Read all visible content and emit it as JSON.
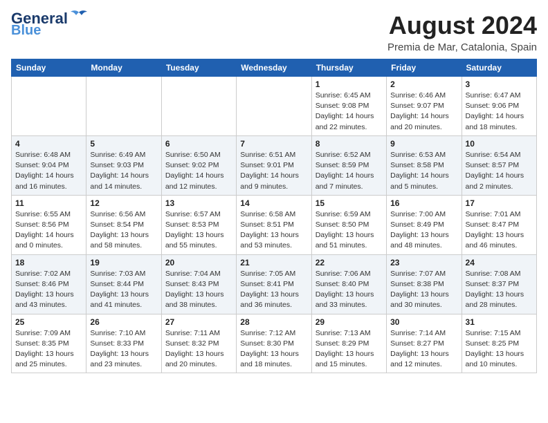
{
  "header": {
    "logo_general": "General",
    "logo_blue": "Blue",
    "month_title": "August 2024",
    "subtitle": "Premia de Mar, Catalonia, Spain"
  },
  "weekdays": [
    "Sunday",
    "Monday",
    "Tuesday",
    "Wednesday",
    "Thursday",
    "Friday",
    "Saturday"
  ],
  "weeks": [
    [
      {
        "day": "",
        "info": ""
      },
      {
        "day": "",
        "info": ""
      },
      {
        "day": "",
        "info": ""
      },
      {
        "day": "",
        "info": ""
      },
      {
        "day": "1",
        "info": "Sunrise: 6:45 AM\nSunset: 9:08 PM\nDaylight: 14 hours\nand 22 minutes."
      },
      {
        "day": "2",
        "info": "Sunrise: 6:46 AM\nSunset: 9:07 PM\nDaylight: 14 hours\nand 20 minutes."
      },
      {
        "day": "3",
        "info": "Sunrise: 6:47 AM\nSunset: 9:06 PM\nDaylight: 14 hours\nand 18 minutes."
      }
    ],
    [
      {
        "day": "4",
        "info": "Sunrise: 6:48 AM\nSunset: 9:04 PM\nDaylight: 14 hours\nand 16 minutes."
      },
      {
        "day": "5",
        "info": "Sunrise: 6:49 AM\nSunset: 9:03 PM\nDaylight: 14 hours\nand 14 minutes."
      },
      {
        "day": "6",
        "info": "Sunrise: 6:50 AM\nSunset: 9:02 PM\nDaylight: 14 hours\nand 12 minutes."
      },
      {
        "day": "7",
        "info": "Sunrise: 6:51 AM\nSunset: 9:01 PM\nDaylight: 14 hours\nand 9 minutes."
      },
      {
        "day": "8",
        "info": "Sunrise: 6:52 AM\nSunset: 8:59 PM\nDaylight: 14 hours\nand 7 minutes."
      },
      {
        "day": "9",
        "info": "Sunrise: 6:53 AM\nSunset: 8:58 PM\nDaylight: 14 hours\nand 5 minutes."
      },
      {
        "day": "10",
        "info": "Sunrise: 6:54 AM\nSunset: 8:57 PM\nDaylight: 14 hours\nand 2 minutes."
      }
    ],
    [
      {
        "day": "11",
        "info": "Sunrise: 6:55 AM\nSunset: 8:56 PM\nDaylight: 14 hours\nand 0 minutes."
      },
      {
        "day": "12",
        "info": "Sunrise: 6:56 AM\nSunset: 8:54 PM\nDaylight: 13 hours\nand 58 minutes."
      },
      {
        "day": "13",
        "info": "Sunrise: 6:57 AM\nSunset: 8:53 PM\nDaylight: 13 hours\nand 55 minutes."
      },
      {
        "day": "14",
        "info": "Sunrise: 6:58 AM\nSunset: 8:51 PM\nDaylight: 13 hours\nand 53 minutes."
      },
      {
        "day": "15",
        "info": "Sunrise: 6:59 AM\nSunset: 8:50 PM\nDaylight: 13 hours\nand 51 minutes."
      },
      {
        "day": "16",
        "info": "Sunrise: 7:00 AM\nSunset: 8:49 PM\nDaylight: 13 hours\nand 48 minutes."
      },
      {
        "day": "17",
        "info": "Sunrise: 7:01 AM\nSunset: 8:47 PM\nDaylight: 13 hours\nand 46 minutes."
      }
    ],
    [
      {
        "day": "18",
        "info": "Sunrise: 7:02 AM\nSunset: 8:46 PM\nDaylight: 13 hours\nand 43 minutes."
      },
      {
        "day": "19",
        "info": "Sunrise: 7:03 AM\nSunset: 8:44 PM\nDaylight: 13 hours\nand 41 minutes."
      },
      {
        "day": "20",
        "info": "Sunrise: 7:04 AM\nSunset: 8:43 PM\nDaylight: 13 hours\nand 38 minutes."
      },
      {
        "day": "21",
        "info": "Sunrise: 7:05 AM\nSunset: 8:41 PM\nDaylight: 13 hours\nand 36 minutes."
      },
      {
        "day": "22",
        "info": "Sunrise: 7:06 AM\nSunset: 8:40 PM\nDaylight: 13 hours\nand 33 minutes."
      },
      {
        "day": "23",
        "info": "Sunrise: 7:07 AM\nSunset: 8:38 PM\nDaylight: 13 hours\nand 30 minutes."
      },
      {
        "day": "24",
        "info": "Sunrise: 7:08 AM\nSunset: 8:37 PM\nDaylight: 13 hours\nand 28 minutes."
      }
    ],
    [
      {
        "day": "25",
        "info": "Sunrise: 7:09 AM\nSunset: 8:35 PM\nDaylight: 13 hours\nand 25 minutes."
      },
      {
        "day": "26",
        "info": "Sunrise: 7:10 AM\nSunset: 8:33 PM\nDaylight: 13 hours\nand 23 minutes."
      },
      {
        "day": "27",
        "info": "Sunrise: 7:11 AM\nSunset: 8:32 PM\nDaylight: 13 hours\nand 20 minutes."
      },
      {
        "day": "28",
        "info": "Sunrise: 7:12 AM\nSunset: 8:30 PM\nDaylight: 13 hours\nand 18 minutes."
      },
      {
        "day": "29",
        "info": "Sunrise: 7:13 AM\nSunset: 8:29 PM\nDaylight: 13 hours\nand 15 minutes."
      },
      {
        "day": "30",
        "info": "Sunrise: 7:14 AM\nSunset: 8:27 PM\nDaylight: 13 hours\nand 12 minutes."
      },
      {
        "day": "31",
        "info": "Sunrise: 7:15 AM\nSunset: 8:25 PM\nDaylight: 13 hours\nand 10 minutes."
      }
    ]
  ]
}
